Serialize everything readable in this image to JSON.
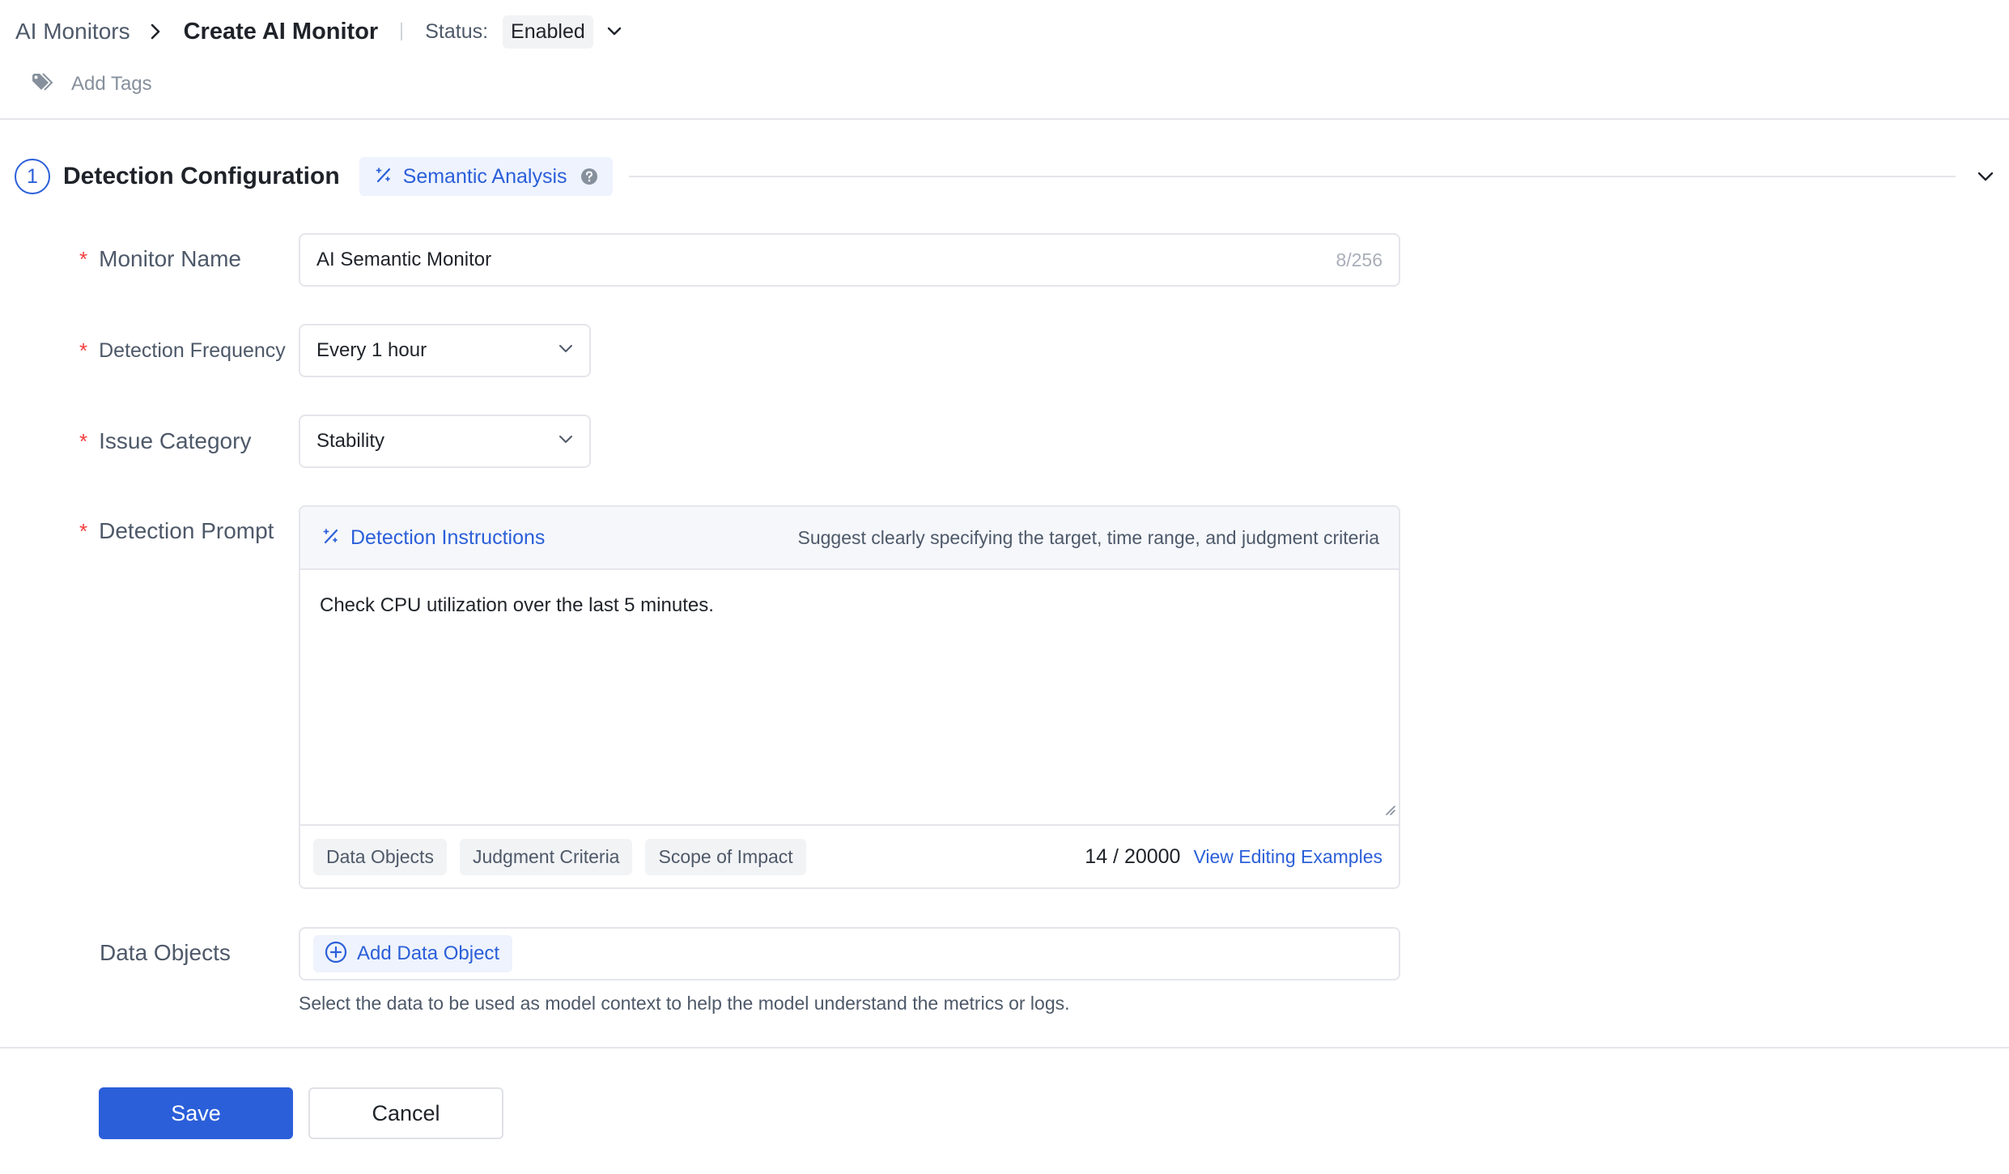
{
  "header": {
    "breadcrumb_root": "AI Monitors",
    "breadcrumb_current": "Create AI Monitor",
    "status_label": "Status:",
    "status_value": "Enabled",
    "add_tags_label": "Add Tags"
  },
  "section": {
    "step_number": "1",
    "title": "Detection Configuration",
    "analysis_chip": "Semantic Analysis"
  },
  "form": {
    "monitor_name": {
      "label": "Monitor Name",
      "value": "AI Semantic Monitor",
      "counter": "8/256"
    },
    "detection_frequency": {
      "label": "Detection Frequency",
      "value": "Every 1 hour"
    },
    "issue_category": {
      "label": "Issue Category",
      "value": "Stability"
    },
    "detection_prompt": {
      "label": "Detection Prompt",
      "header_title": "Detection Instructions",
      "hint": "Suggest clearly specifying the target, time range, and judgment criteria",
      "text": "Check CPU utilization over the last 5 minutes.",
      "chips": [
        "Data Objects",
        "Judgment Criteria",
        "Scope of Impact"
      ],
      "count": "14 / 20000",
      "view_examples": "View Editing Examples"
    },
    "data_objects": {
      "label": "Data Objects",
      "add_button": "Add Data Object",
      "hint": "Select the data to be used as model context to help the model understand the metrics or logs."
    }
  },
  "actions": {
    "save": "Save",
    "cancel": "Cancel"
  },
  "colors": {
    "primary": "#2b5fd9",
    "required": "#f53f3f",
    "border": "#e5e6eb"
  },
  "icons": [
    "chevron-right-icon",
    "chevron-down-icon",
    "tag-icon",
    "sparkle-wand-icon",
    "help-circle-icon",
    "plus-circle-icon",
    "resize-grip-icon"
  ]
}
